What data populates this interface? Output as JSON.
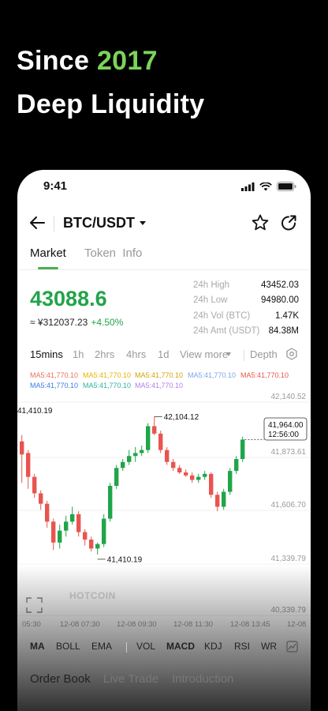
{
  "hero": {
    "line1_prefix": "Since",
    "line1_accent": "2017",
    "line2": "Deep Liquidity"
  },
  "status": {
    "time": "9:41"
  },
  "nav": {
    "pair": "BTC/USDT"
  },
  "tabs": [
    {
      "label": "Market"
    },
    {
      "label": "Token  Info"
    }
  ],
  "ticker": {
    "last_price": "43088.6",
    "fiat": "≈ ¥312037.23",
    "change": "+4.50%"
  },
  "stats": [
    {
      "label": "24h High",
      "value": "43452.03"
    },
    {
      "label": "24h Low",
      "value": "94980.00"
    },
    {
      "label": "24h Vol (BTC)",
      "value": "1.47K"
    },
    {
      "label": "24h Amt (USDT)",
      "value": "84.38M"
    }
  ],
  "timeframes": {
    "t15": "15mins",
    "t1h": "1h",
    "t2h": "2hrs",
    "t4h": "4hrs",
    "t1d": "1d",
    "more": "View more",
    "depth": "Depth"
  },
  "ma_legend": [
    "MA5:41,770.10",
    "MA5:41,770.10",
    "MA5:41,770.10",
    "MA5:41,770.10",
    "MA5:41,770.10",
    "MA5:41,770.10",
    "MA5:41,770.10",
    "MA5:41,770.10"
  ],
  "colors": {
    "up": "#21a44a",
    "down": "#e8554e",
    "accent": "#7cd35a",
    "ma": [
      "#e8705a",
      "#e8b400",
      "#7aa6e6",
      "#e8554e",
      "#3a7be8",
      "#2ab5a0",
      "#b080e8",
      "#e8554e"
    ]
  },
  "chart_data": {
    "type": "candlestick",
    "y_ticks": [
      "42,140.52",
      "41,873.61",
      "41,606.70",
      "41,339.79",
      "40,339.79"
    ],
    "x_ticks": [
      "05:30",
      "12-08 07:30",
      "12-08 09:30",
      "12-08 11:30",
      "12-08 13:45",
      "12-08"
    ],
    "high_label": "42,104.12",
    "low_label": "41,410.19",
    "left_label": "41,410.19",
    "tooltip": {
      "price": "41,964.00",
      "time": "12:56:00"
    },
    "watermark": "HOTCOIN",
    "candles": [
      [
        41938,
        41980,
        41660,
        41850
      ],
      [
        41860,
        41880,
        41620,
        41700
      ],
      [
        41700,
        41720,
        41560,
        41590
      ],
      [
        41590,
        41610,
        41480,
        41520
      ],
      [
        41520,
        41540,
        41360,
        41400
      ],
      [
        41400,
        41420,
        41210,
        41260
      ],
      [
        41260,
        41380,
        41220,
        41340
      ],
      [
        41340,
        41440,
        41300,
        41400
      ],
      [
        41400,
        41500,
        41380,
        41450
      ],
      [
        41450,
        41470,
        41300,
        41330
      ],
      [
        41330,
        41350,
        41240,
        41280
      ],
      [
        41280,
        41300,
        41200,
        41220
      ],
      [
        41220,
        41260,
        41180,
        41250
      ],
      [
        41250,
        41450,
        41230,
        41420
      ],
      [
        41420,
        41660,
        41400,
        41640
      ],
      [
        41640,
        41780,
        41620,
        41760
      ],
      [
        41760,
        41820,
        41740,
        41800
      ],
      [
        41800,
        41880,
        41780,
        41840
      ],
      [
        41840,
        41900,
        41800,
        41860
      ],
      [
        41860,
        41910,
        41840,
        41880
      ],
      [
        41880,
        42060,
        41860,
        42040
      ],
      [
        42040,
        42104,
        41980,
        41990
      ],
      [
        41990,
        42010,
        41860,
        41880
      ],
      [
        41880,
        41900,
        41780,
        41800
      ],
      [
        41800,
        41820,
        41740,
        41760
      ],
      [
        41760,
        41780,
        41720,
        41730
      ],
      [
        41730,
        41750,
        41700,
        41710
      ],
      [
        41710,
        41730,
        41660,
        41680
      ],
      [
        41680,
        41720,
        41660,
        41700
      ],
      [
        41700,
        41740,
        41680,
        41720
      ],
      [
        41720,
        41730,
        41560,
        41580
      ],
      [
        41580,
        41600,
        41470,
        41500
      ],
      [
        41500,
        41620,
        41480,
        41600
      ],
      [
        41600,
        41760,
        41580,
        41740
      ],
      [
        41740,
        41840,
        41720,
        41820
      ],
      [
        41820,
        41970,
        41800,
        41950
      ]
    ],
    "y_range": [
      41100,
      42180
    ]
  },
  "indicators": {
    "ma": "MA",
    "boll": "BOLL",
    "ema": "EMA",
    "vol": "VOL",
    "macd": "MACD",
    "kdj": "KDJ",
    "rsi": "RSI",
    "wr": "WR"
  },
  "bottom_tabs": [
    "Order Book",
    "Live Trade",
    "Introduction"
  ]
}
